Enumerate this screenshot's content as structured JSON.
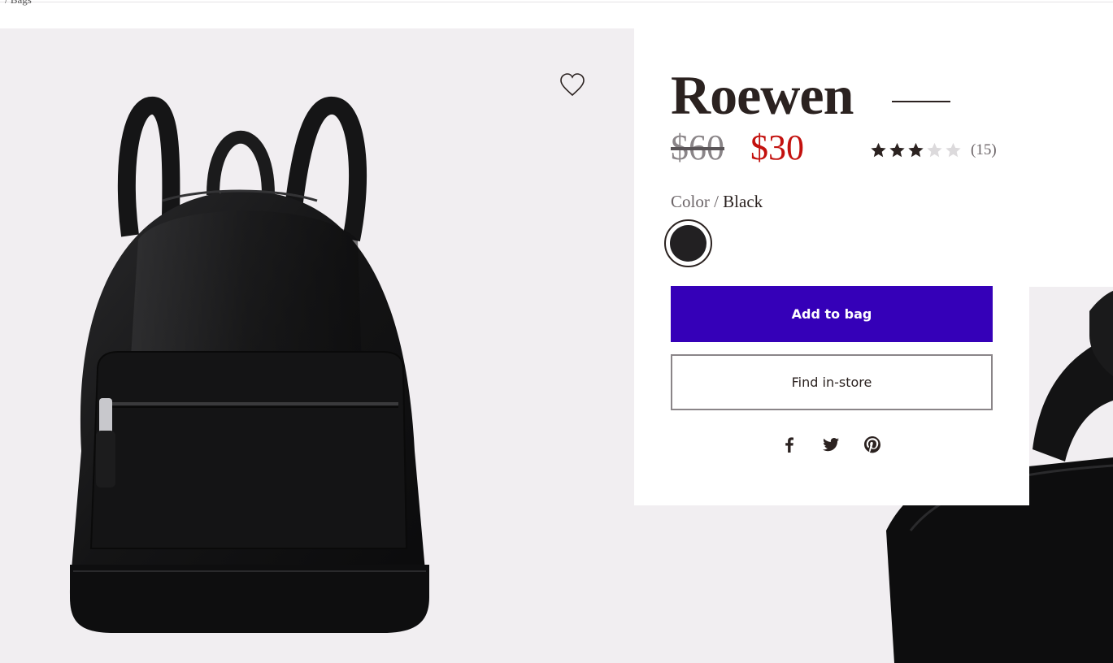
{
  "breadcrumb": {
    "text": "/ Bags"
  },
  "product": {
    "name": "Roewen",
    "price_original": "$60",
    "price_sale": "$30",
    "rating": {
      "stars": 3,
      "max": 5,
      "count_label": "(15)"
    },
    "color": {
      "label": "Color /",
      "value": "Black",
      "swatch_hex": "#222022"
    }
  },
  "actions": {
    "add_to_bag": "Add to bag",
    "find_in_store": "Find in-store"
  },
  "share": {
    "icons": [
      "facebook-icon",
      "twitter-icon",
      "pinterest-icon"
    ]
  },
  "colors": {
    "accent": "#3500b8",
    "sale": "#c3110e",
    "text": "#2b2220",
    "gallery_bg": "#f1eef1"
  }
}
